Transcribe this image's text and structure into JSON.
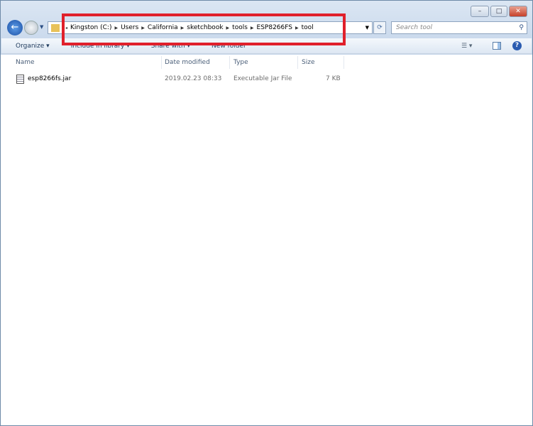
{
  "window": {
    "minimize": "–",
    "maximize": "□",
    "close": "✕"
  },
  "address": {
    "crumbs": [
      "Kingston (C:)",
      "Users",
      "California",
      "sketchbook",
      "tools",
      "ESP8266FS",
      "tool"
    ],
    "separator": "▶"
  },
  "search": {
    "placeholder": "Search tool"
  },
  "toolbar": {
    "organize": "Organize ▾",
    "include": "Include in library ▾",
    "share": "Share with ▾",
    "new_folder": "New folder"
  },
  "columns": {
    "name": "Name",
    "date": "Date modified",
    "type": "Type",
    "size": "Size"
  },
  "files": [
    {
      "name": "esp8266fs.jar",
      "date": "2019.02.23 08:33",
      "type": "Executable Jar File",
      "size": "7 KB"
    }
  ],
  "highlight_color": "#e0202b"
}
